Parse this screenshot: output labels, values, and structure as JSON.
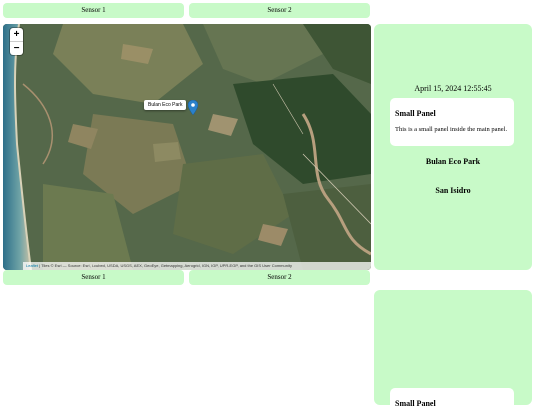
{
  "top_tabs": [
    {
      "label": "Sensor 1"
    },
    {
      "label": "Sensor 2"
    }
  ],
  "bottom_tabs": [
    {
      "label": "Sensor 1"
    },
    {
      "label": "Sensor 2"
    }
  ],
  "map": {
    "zoom_in_label": "+",
    "zoom_out_label": "−",
    "marker_tooltip": "Bulan Eco Park",
    "attribution_link": "Leaflet",
    "attribution_text": " | Tiles © Esri — Source: Esri, i-cubed, USDA, USGS, AEX, GeoEye, Getmapping, Aerogrid, IGN, IGP, UPR-EGP, and the GIS User Community",
    "marker_icon": "map-pin-icon",
    "marker_color": "#2a81cb"
  },
  "main_panel": {
    "datetime": "April 15, 2024 12:55:45",
    "small_panel": {
      "title": "Small Panel",
      "text": "This is a small panel inside the main panel."
    },
    "location_1": "Bulan Eco Park",
    "location_2": "San Isidro"
  },
  "second_panel": {
    "small_panel_title": "Small Panel"
  },
  "colors": {
    "panel_bg": "#c8fac8",
    "link": "#0078a8"
  }
}
